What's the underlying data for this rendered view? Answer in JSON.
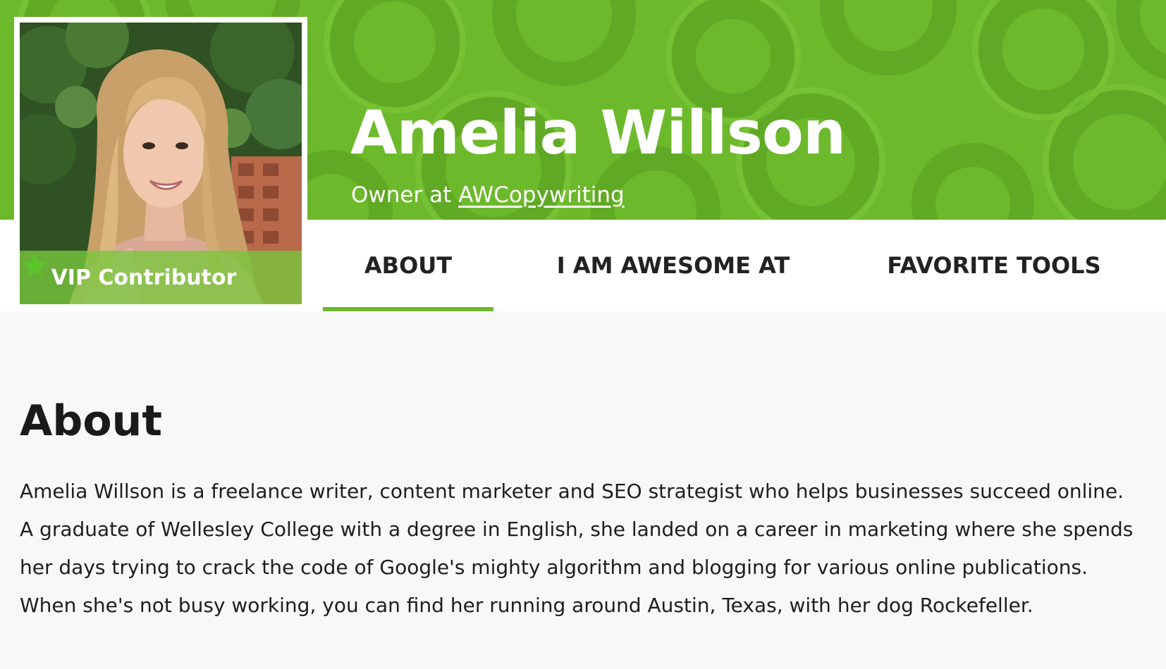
{
  "profile": {
    "name": "Amelia Willson",
    "role_prefix": "Owner at",
    "company": "AWCopywriting",
    "badge": "VIP Contributor",
    "badge_icon": "star-icon"
  },
  "tabs": [
    {
      "label": "ABOUT",
      "active": true
    },
    {
      "label": "I AM AWESOME AT",
      "active": false
    },
    {
      "label": "FAVORITE TOOLS",
      "active": false
    }
  ],
  "about": {
    "heading": "About",
    "lines": [
      "Amelia Willson is a freelance writer, content marketer and SEO strategist who helps businesses succeed online.",
      "A graduate of Wellesley College with a degree in English, she landed on a career in marketing where she spends",
      "her days trying to crack the code of Google's mighty algorithm and blogging for various online publications.",
      "When she's not busy working, you can find her running around Austin, Texas, with her dog Rockefeller."
    ]
  },
  "colors": {
    "brand_green": "#6db92c",
    "pattern_green": "#5fa824",
    "page_bg": "#f8f8f8",
    "text": "#1c1c1c"
  }
}
